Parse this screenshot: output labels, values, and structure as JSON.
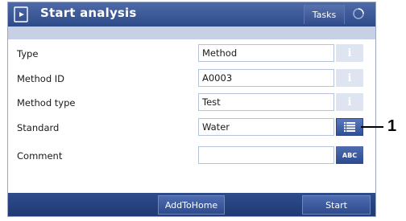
{
  "window": {
    "title": "Start analysis",
    "title_icon": "analysis-document-icon"
  },
  "header": {
    "tasks_label": "Tasks",
    "spinner_icon": "circular-progress-icon"
  },
  "form": {
    "rows": [
      {
        "label": "Type",
        "value": "Method",
        "button": "info-icon",
        "button_text": "i"
      },
      {
        "label": "Method ID",
        "value": "A0003",
        "button": "info-icon",
        "button_text": "i"
      },
      {
        "label": "Method type",
        "value": "Test",
        "button": "info-icon",
        "button_text": "i"
      },
      {
        "label": "Standard",
        "value": "Water",
        "button": "list-icon",
        "button_text": ""
      },
      {
        "label": "Comment",
        "value": "",
        "button": "keyboard-abc",
        "button_text": "ABC"
      }
    ]
  },
  "footer": {
    "add_to_home_label": "AddToHome",
    "start_label": "Start"
  },
  "callout": {
    "number": "1"
  },
  "colors": {
    "titlebar": "#2d4a89",
    "stripe": "#c7d0e5",
    "info_disabled": "#dfe4f1",
    "button_blue": "#2f4f96"
  }
}
